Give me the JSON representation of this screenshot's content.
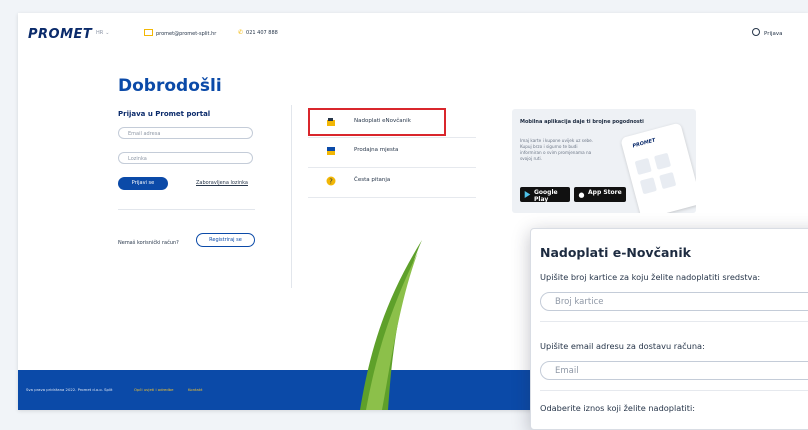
{
  "header": {
    "logo": "PROMET",
    "lang": "HR",
    "email": "promet@promet-split.hr",
    "phone": "021 407 888",
    "login": "Prijava"
  },
  "login": {
    "title": "Dobrodošli",
    "subtitle": "Prijava u Promet portal",
    "email_placeholder": "Email adresa",
    "password_placeholder": "Lozinka",
    "submit_label": "Prijavi se",
    "forgot_label": "Zaboravljena lozinka",
    "no_account_text": "Nemaš korisnički račun?",
    "register_label": "Registriraj se"
  },
  "menu": {
    "items": [
      {
        "label": "Nadoplati eNovčanik",
        "icon": "wallet-icon"
      },
      {
        "label": "Prodajna mjesta",
        "icon": "store-icon"
      },
      {
        "label": "Česta pitanja",
        "icon": "question-icon"
      }
    ]
  },
  "promo": {
    "title": "Mobilna aplikacija daje ti brojne pogodnosti",
    "text": "Imaj karte i kupone uvijek uz sebe. Kupuj brzo i sigurno te budi informiran o svim promjenama na svojoj ruti.",
    "google_label": "Google Play",
    "apple_label": "App Store",
    "app_brand": "PROMET"
  },
  "footer": {
    "copyright": "Sva prava pridržana 2022. Promet d.o.o. Split",
    "terms": "Opći uvjeti i odredbe",
    "contact": "Kontakt"
  },
  "popup": {
    "title": "Nadoplati e-Novčanik",
    "card_label": "Upišite broj kartice za koju želite nadoplatiti sredstva:",
    "card_placeholder": "Broj kartice",
    "email_label": "Upišite email adresu za dostavu računa:",
    "email_placeholder": "Email",
    "amount_label": "Odaberite iznos koji želite nadoplatiti:"
  },
  "colors": {
    "brand_blue": "#0b4aa8",
    "accent_yellow": "#f2b705",
    "highlight_red": "#d9262c",
    "arrow_green": "#5ea02a"
  }
}
